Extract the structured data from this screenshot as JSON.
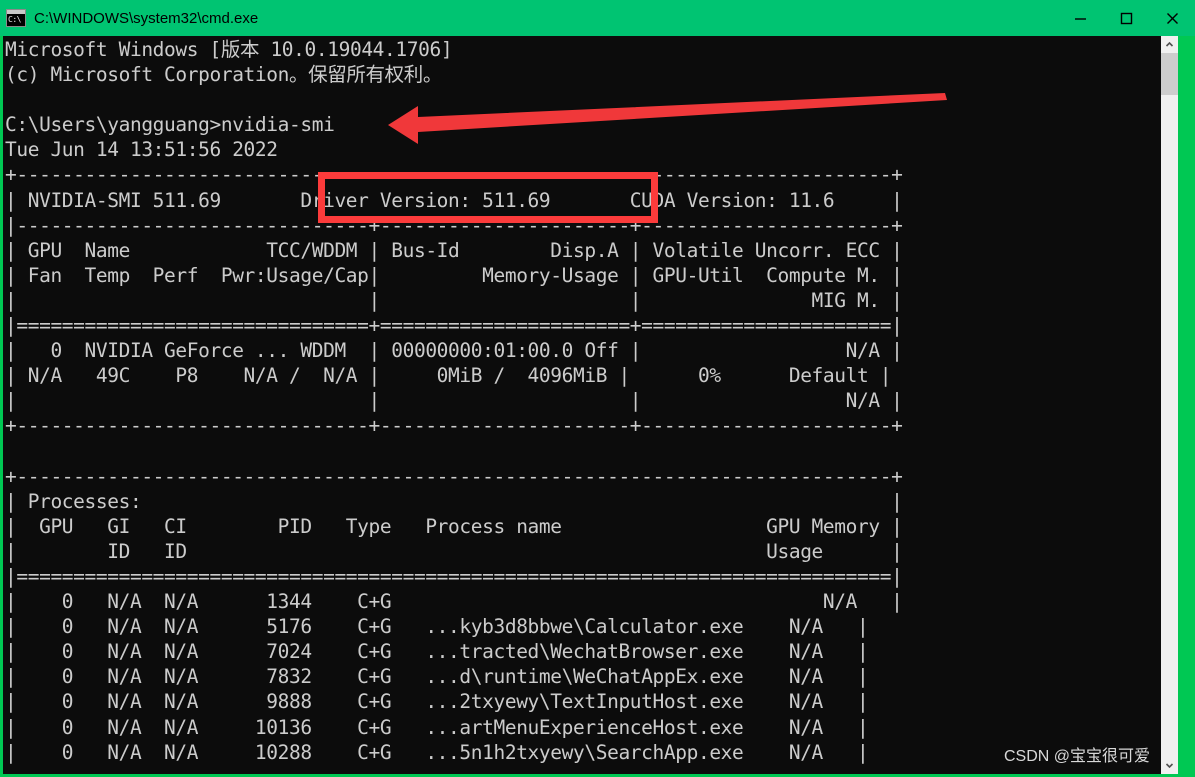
{
  "window": {
    "title": "C:\\WINDOWS\\system32\\cmd.exe",
    "icon": "cmd-console-icon",
    "icon_glyph": "C:\\",
    "titlebar_color": "#00c472",
    "border_color": "#00c853",
    "terminal_bg": "#0c0c0c",
    "terminal_fg": "#cccccc",
    "controls": {
      "minimize": "minimize-icon",
      "maximize": "maximize-icon",
      "close": "close-icon"
    }
  },
  "scrollbar": {
    "up_arrow": "chevron-up-icon",
    "down_arrow": "chevron-down-icon",
    "thumb": "scrollbar-thumb"
  },
  "console": {
    "lines": [
      "Microsoft Windows [版本 10.0.19044.1706]",
      "(c) Microsoft Corporation。保留所有权利。",
      "",
      "C:\\Users\\yangguang>nvidia-smi",
      "Tue Jun 14 13:51:56 2022",
      "+-----------------------------------------------------------------------------+",
      "| NVIDIA-SMI 511.69       Driver Version: 511.69       CUDA Version: 11.6     |",
      "|-------------------------------+----------------------+----------------------+",
      "| GPU  Name            TCC/WDDM | Bus-Id        Disp.A | Volatile Uncorr. ECC |",
      "| Fan  Temp  Perf  Pwr:Usage/Cap|         Memory-Usage | GPU-Util  Compute M. |",
      "|                               |                      |               MIG M. |",
      "|===============================+======================+======================|",
      "|   0  NVIDIA GeForce ... WDDM  | 00000000:01:00.0 Off |                  N/A |",
      "| N/A   49C    P8    N/A /  N/A |     0MiB /  4096MiB |      0%      Default |",
      "|                               |                      |                  N/A |",
      "+-------------------------------+----------------------+----------------------+",
      "",
      "+-----------------------------------------------------------------------------+",
      "| Processes:                                                                  |",
      "|  GPU   GI   CI        PID   Type   Process name                  GPU Memory |",
      "|        ID   ID                                                   Usage      |",
      "|=============================================================================|",
      "|    0   N/A  N/A      1344    C+G                                      N/A   |",
      "|    0   N/A  N/A      5176    C+G   ...kyb3d8bbwe\\Calculator.exe    N/A   |",
      "|    0   N/A  N/A      7024    C+G   ...tracted\\WechatBrowser.exe    N/A   |",
      "|    0   N/A  N/A      7832    C+G   ...d\\runtime\\WeChatAppEx.exe    N/A   |",
      "|    0   N/A  N/A      9888    C+G   ...2txyewy\\TextInputHost.exe    N/A   |",
      "|    0   N/A  N/A     10136    C+G   ...artMenuExperienceHost.exe    N/A   |",
      "|    0   N/A  N/A     10288    C+G   ...5n1h2txyewy\\SearchApp.exe    N/A   |"
    ]
  },
  "nvidia_smi": {
    "smi_version": "511.69",
    "driver_version": "511.69",
    "cuda_version": "11.6",
    "timestamp": "Tue Jun 14 13:51:56 2022",
    "command": "nvidia-smi",
    "prompt": "C:\\Users\\yangguang>",
    "gpu_table_headers_row1": [
      "GPU",
      "Name",
      "TCC/WDDM",
      "Bus-Id",
      "Disp.A",
      "Volatile Uncorr. ECC"
    ],
    "gpu_table_headers_row2": [
      "Fan",
      "Temp",
      "Perf",
      "Pwr:Usage/Cap",
      "Memory-Usage",
      "GPU-Util",
      "Compute M."
    ],
    "gpu_table_headers_row3": [
      "MIG M."
    ],
    "gpus": [
      {
        "index": "0",
        "name": "NVIDIA GeForce ...",
        "driver_model": "WDDM",
        "bus_id": "00000000:01:00.0",
        "disp_a": "Off",
        "ecc": "N/A",
        "fan": "N/A",
        "temp": "49C",
        "perf": "P8",
        "pwr_usage_cap": "N/A /  N/A",
        "memory_usage": "0MiB /  4096MiB",
        "gpu_util": "0%",
        "compute_m": "Default",
        "mig_m": "N/A"
      }
    ],
    "processes_label": "Processes:",
    "process_headers": [
      "GPU",
      "GI",
      "CI",
      "PID",
      "Type",
      "Process name",
      "GPU Memory"
    ],
    "process_headers_sub": [
      "ID",
      "ID",
      "Usage"
    ],
    "processes": [
      {
        "gpu": "0",
        "gi": "N/A",
        "ci": "N/A",
        "pid": "1344",
        "type": "C+G",
        "name": "",
        "memory": "N/A"
      },
      {
        "gpu": "0",
        "gi": "N/A",
        "ci": "N/A",
        "pid": "5176",
        "type": "C+G",
        "name": "...kyb3d8bbwe\\Calculator.exe",
        "memory": "N/A"
      },
      {
        "gpu": "0",
        "gi": "N/A",
        "ci": "N/A",
        "pid": "7024",
        "type": "C+G",
        "name": "...tracted\\WechatBrowser.exe",
        "memory": "N/A"
      },
      {
        "gpu": "0",
        "gi": "N/A",
        "ci": "N/A",
        "pid": "7832",
        "type": "C+G",
        "name": "...d\\runtime\\WeChatAppEx.exe",
        "memory": "N/A"
      },
      {
        "gpu": "0",
        "gi": "N/A",
        "ci": "N/A",
        "pid": "9888",
        "type": "C+G",
        "name": "...2txyewy\\TextInputHost.exe",
        "memory": "N/A"
      },
      {
        "gpu": "0",
        "gi": "N/A",
        "ci": "N/A",
        "pid": "10136",
        "type": "C+G",
        "name": "...artMenuExperienceHost.exe",
        "memory": "N/A"
      },
      {
        "gpu": "0",
        "gi": "N/A",
        "ci": "N/A",
        "pid": "10288",
        "type": "C+G",
        "name": "...5n1h2txyewy\\SearchApp.exe",
        "memory": "N/A"
      }
    ]
  },
  "annotations": {
    "highlight_color": "#fc3b3b",
    "box_target": "Driver Version: 511.69",
    "arrow_target": "nvidia-smi"
  },
  "watermark": {
    "text": "CSDN @宝宝很可爱"
  }
}
